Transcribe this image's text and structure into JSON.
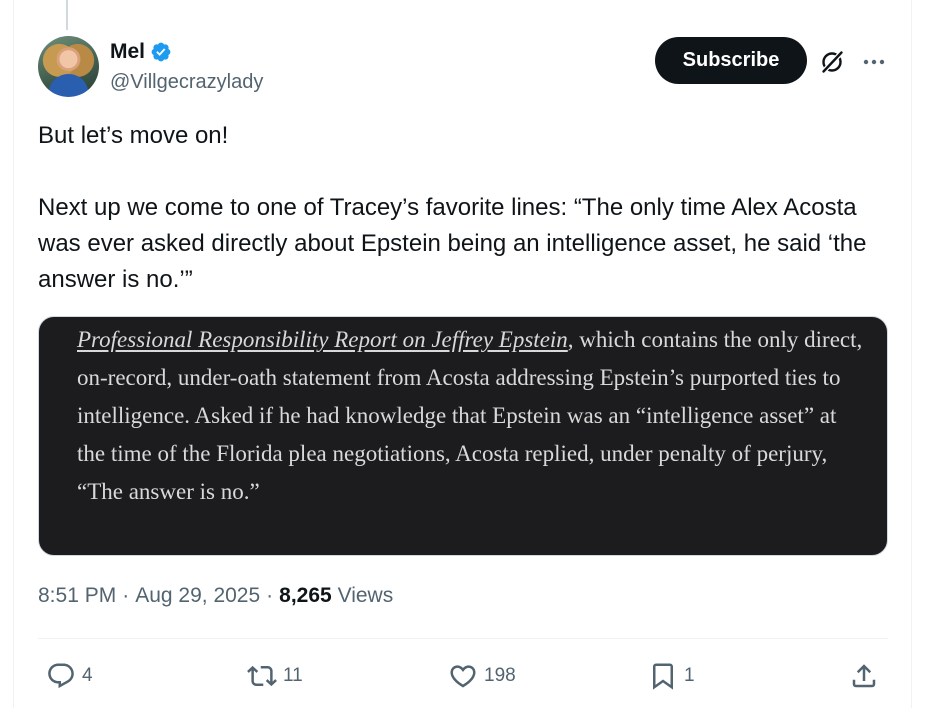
{
  "author": {
    "display_name": "Mel",
    "handle": "@Villgecrazylady",
    "verified": true
  },
  "header_actions": {
    "subscribe_label": "Subscribe",
    "icons": [
      "grok-icon",
      "more-icon"
    ]
  },
  "tweet": {
    "text": "But let’s move on!\n\nNext up we come to one of Tracey’s favorite lines: “The only time Alex Acosta was ever asked directly about Epstein being an intelligence asset, he said ‘the answer is no.’”"
  },
  "quote_image": {
    "link_text": "Professional Responsibility Report on Jeffrey Epstein",
    "body_text": ", which contains the only direct, on-record, under-oath statement from Acosta addressing Epstein’s purported ties to intelligence. Asked if he had knowledge that Epstein was an “intelligence asset” at the time of the Florida plea negotiations, Acosta replied, under penalty of perjury, “The answer is no.”"
  },
  "meta": {
    "time": "8:51 PM",
    "separator": "·",
    "date": "Aug 29, 2025",
    "views_count": "8,265",
    "views_label": "Views"
  },
  "actions": {
    "replies": "4",
    "reposts": "11",
    "likes": "198",
    "bookmarks": "1"
  },
  "colors": {
    "verified_badge": "#1d9bf0",
    "text_primary": "#0f1419",
    "text_secondary": "#536471",
    "subscribe_bg": "#0f1419"
  }
}
